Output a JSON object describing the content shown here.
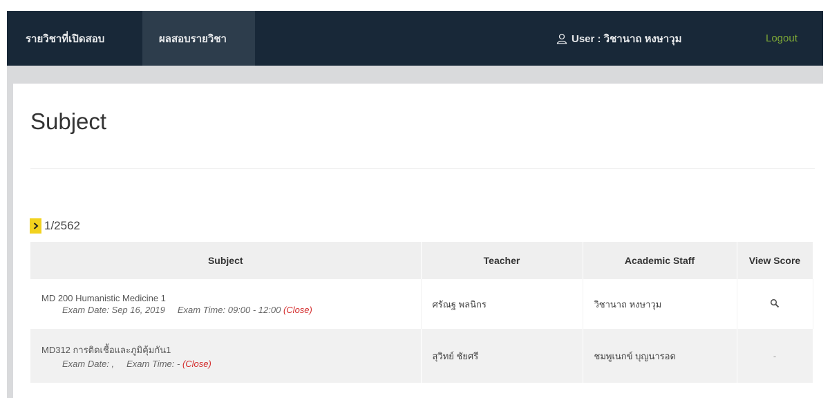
{
  "nav": {
    "items": [
      {
        "label": "รายวิชาที่เปิดสอบ"
      },
      {
        "label": "ผลสอบรายวิชา"
      }
    ],
    "user_label": "User : วิชานาถ หงษาวุม",
    "logout_label": "Logout",
    "logout_color": "#7ea936",
    "bg_color": "#182838",
    "active_item_bg": "#2d3d4c"
  },
  "page": {
    "title": "Subject"
  },
  "term": {
    "label": "1/2562",
    "toggle_icon": "chevron-right-icon",
    "toggle_color": "#f2d21e"
  },
  "table": {
    "headers": [
      "Subject",
      "Teacher",
      "Academic Staff",
      "View Score"
    ],
    "rows": [
      {
        "subject": "MD 200 Humanistic Medicine 1",
        "exam_date": "Exam Date: Sep 16, 2019",
        "exam_time": "Exam Time: 09:00 - 12:00",
        "status": "(Close)",
        "teacher": "ศรัณฐ พลนิกร",
        "staff": "วิชานาถ หงษาวุม",
        "view_score": "search-icon"
      },
      {
        "subject": "MD312 การติดเชื้อและภูมิคุ้มกัน1",
        "exam_date": "Exam Date: ,",
        "exam_time": "Exam Time: -",
        "status": "(Close)",
        "teacher": "สุวิทย์ ชัยศรี",
        "staff": "ชมพูเนกข์ บุญนารอด",
        "view_score": "-"
      }
    ]
  },
  "colors": {
    "status_closed": "#d42c2c"
  }
}
